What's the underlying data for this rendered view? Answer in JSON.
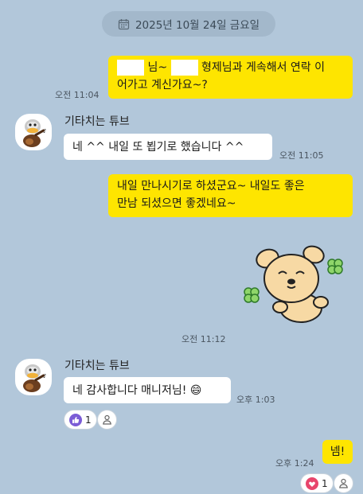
{
  "date_header": {
    "text": "2025년 10월 24일 금요일",
    "icon": "calendar-icon"
  },
  "messages": [
    {
      "side": "me",
      "pre_text": "님~",
      "post_text": "형제님과 게속해서 연락 이",
      "line2": "어가고 계신가요~?",
      "time": "오전 11:04"
    },
    {
      "side": "other",
      "sender": "기타치는 튜브",
      "text": "네 ^^ 내일 또 뵙기로 했습니다 ^^",
      "time": "오전 11:05"
    },
    {
      "side": "me",
      "line1": "내일 만나시기로 하셨군요~ 내일도 좋은",
      "line2": "만남 되셨으면 좋겠네요~",
      "sticker": "puppy-clover-sticker",
      "time": "오전 11:12"
    },
    {
      "side": "other",
      "sender": "기타치는 튜브",
      "text": "네 감사합니다 매니저님!",
      "emoji": "😄",
      "time": "오후 1:03",
      "reaction": {
        "icon": "thumbs-up-icon",
        "count": "1"
      }
    },
    {
      "side": "me",
      "text": "넴!",
      "time": "오후 1:24",
      "reaction": {
        "icon": "heart-icon",
        "count": "1"
      }
    }
  ],
  "colors": {
    "background": "#b2c7da",
    "my_bubble": "#fee500",
    "other_bubble": "#ffffff",
    "thumbs": "#7b5cd6",
    "heart": "#e8456c"
  }
}
